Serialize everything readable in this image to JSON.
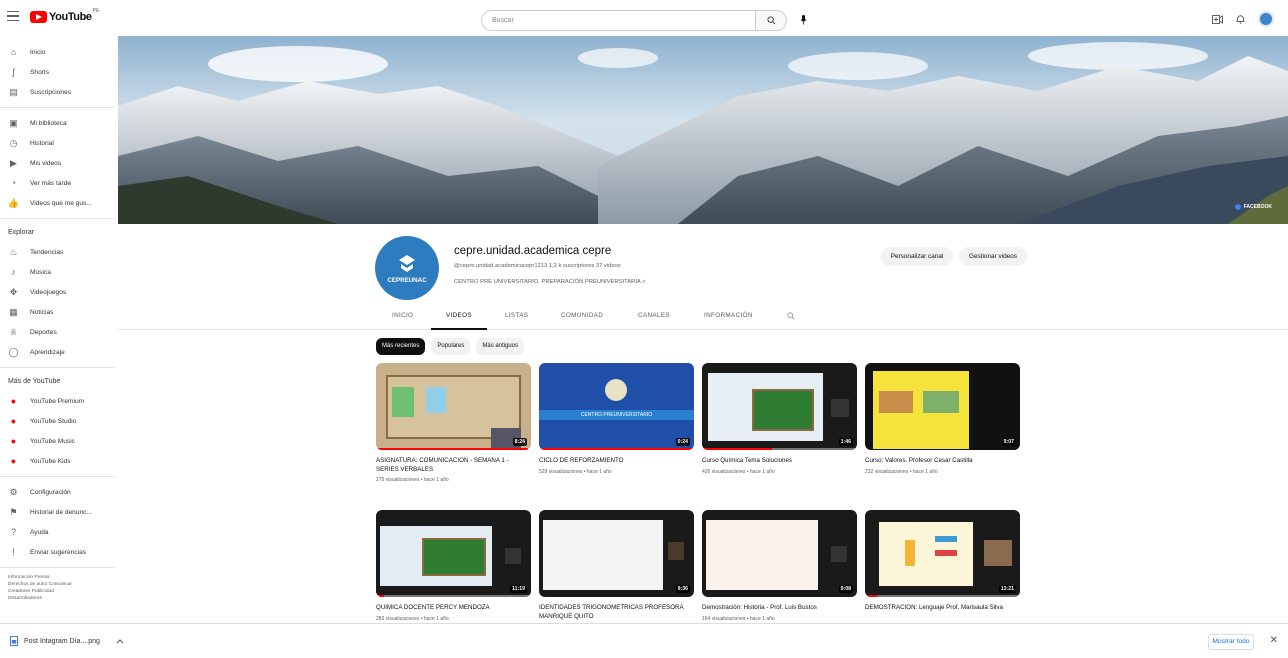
{
  "topbar": {
    "logo_text": "YouTube",
    "country": "PE",
    "search_placeholder": "Buscar"
  },
  "sidebar": {
    "main": [
      {
        "label": "Inicio",
        "icon": "home-icon"
      },
      {
        "label": "Shorts",
        "icon": "shorts-icon"
      },
      {
        "label": "Suscripciones",
        "icon": "subscriptions-icon"
      }
    ],
    "library": [
      {
        "label": "Mi biblioteca",
        "icon": "library-icon"
      },
      {
        "label": "Historial",
        "icon": "history-icon"
      },
      {
        "label": "Mis videos",
        "icon": "my-videos-icon"
      },
      {
        "label": "Ver más tarde",
        "icon": "watch-later-icon"
      },
      {
        "label": "Videos que me gus...",
        "icon": "liked-icon"
      }
    ],
    "explore_heading": "Explorar",
    "explore": [
      {
        "label": "Tendencias",
        "icon": "trending-icon"
      },
      {
        "label": "Música",
        "icon": "music-icon"
      },
      {
        "label": "Videojuegos",
        "icon": "gaming-icon"
      },
      {
        "label": "Noticias",
        "icon": "news-icon"
      },
      {
        "label": "Deportes",
        "icon": "sports-icon"
      },
      {
        "label": "Aprendizaje",
        "icon": "learning-icon"
      }
    ],
    "more_heading": "Más de YouTube",
    "more": [
      {
        "label": "YouTube Premium",
        "icon": "youtube-premium-icon"
      },
      {
        "label": "YouTube Studio",
        "icon": "youtube-studio-icon"
      },
      {
        "label": "YouTube Music",
        "icon": "youtube-music-icon"
      },
      {
        "label": "YouTube Kids",
        "icon": "youtube-kids-icon"
      }
    ],
    "settings": [
      {
        "label": "Configuración",
        "icon": "settings-icon"
      },
      {
        "label": "Historial de denunc...",
        "icon": "flag-icon"
      },
      {
        "label": "Ayuda",
        "icon": "help-icon"
      },
      {
        "label": "Enviar sugerencias",
        "icon": "feedback-icon"
      }
    ],
    "footer_line1": "Información  Prensa",
    "footer_line2": "Derechos de autor  Comunicar",
    "footer_line3": "Creadores  Publicidad",
    "footer_line4": "Desarrolladores"
  },
  "banner": {
    "link_label": "FACEBOOK"
  },
  "channel": {
    "avatar_text": "CEPREUNAC",
    "name": "cepre.unidad.academica cepre",
    "meta": "@cepre.unidad.academicacepr1213  1,2 k suscriptores  37 videos",
    "description": "CENTRO PRE UNIVERSITARIO. PREPARACIÓN PREUNIVERSITARIA  >",
    "customize_label": "Personalizar canal",
    "manage_label": "Gestionar videos"
  },
  "tabs": [
    "INICIO",
    "VIDEOS",
    "LISTAS",
    "COMUNIDAD",
    "CANALES",
    "INFORMACIÓN"
  ],
  "chips": [
    "Más recientes",
    "Populares",
    "Más antiguos"
  ],
  "videos": [
    {
      "title": "ASIGNATURA: COMUNICACIÓN - SEMANA 1 - SERIES VERBALES",
      "meta": "275 visualizaciones • hace 1 año",
      "duration": "8:24",
      "progress": 0.98
    },
    {
      "title": "CICLO DE REFORZAMIENTO",
      "meta": "529 visualizaciones • hace 1 año",
      "duration": "0:24",
      "progress": 1.0,
      "thumb_text": "CENTRO PREUNIVERSITARIO"
    },
    {
      "title": "Curso Química Tema Soluciones",
      "meta": "426 visualizaciones • hace 1 año",
      "duration": "1:46",
      "progress": 0.45
    },
    {
      "title": "Curso: Valores. Profesor Cesar Castilla",
      "meta": "232 visualizaciones • hace 1 año",
      "duration": "9:07",
      "progress": 0.0
    },
    {
      "title": "QUIMICA DOCENTE PERCY MENDOZA",
      "meta": "283 visualizaciones • hace 1 año",
      "duration": "11:19",
      "progress": 0.05
    },
    {
      "title": "IDENTIDADES TRIGONOMETRICAS PROFESORA MANRIQUE QUITO",
      "meta": "",
      "duration": "9:36",
      "progress": 0.0
    },
    {
      "title": "Demostración: Historia - Prof. Luis Bustos",
      "meta": "164 visualizaciones • hace 1 año",
      "duration": "9:08",
      "progress": 0.0
    },
    {
      "title": "DEMOSTRACIÓN: Lenguaje Prof. Marisaula Silva",
      "meta": "",
      "duration": "13:21",
      "progress": 0.08
    }
  ],
  "download_bar": {
    "file_name": "Post Intagram Día....png",
    "show_all_label": "Mostrar todo"
  }
}
